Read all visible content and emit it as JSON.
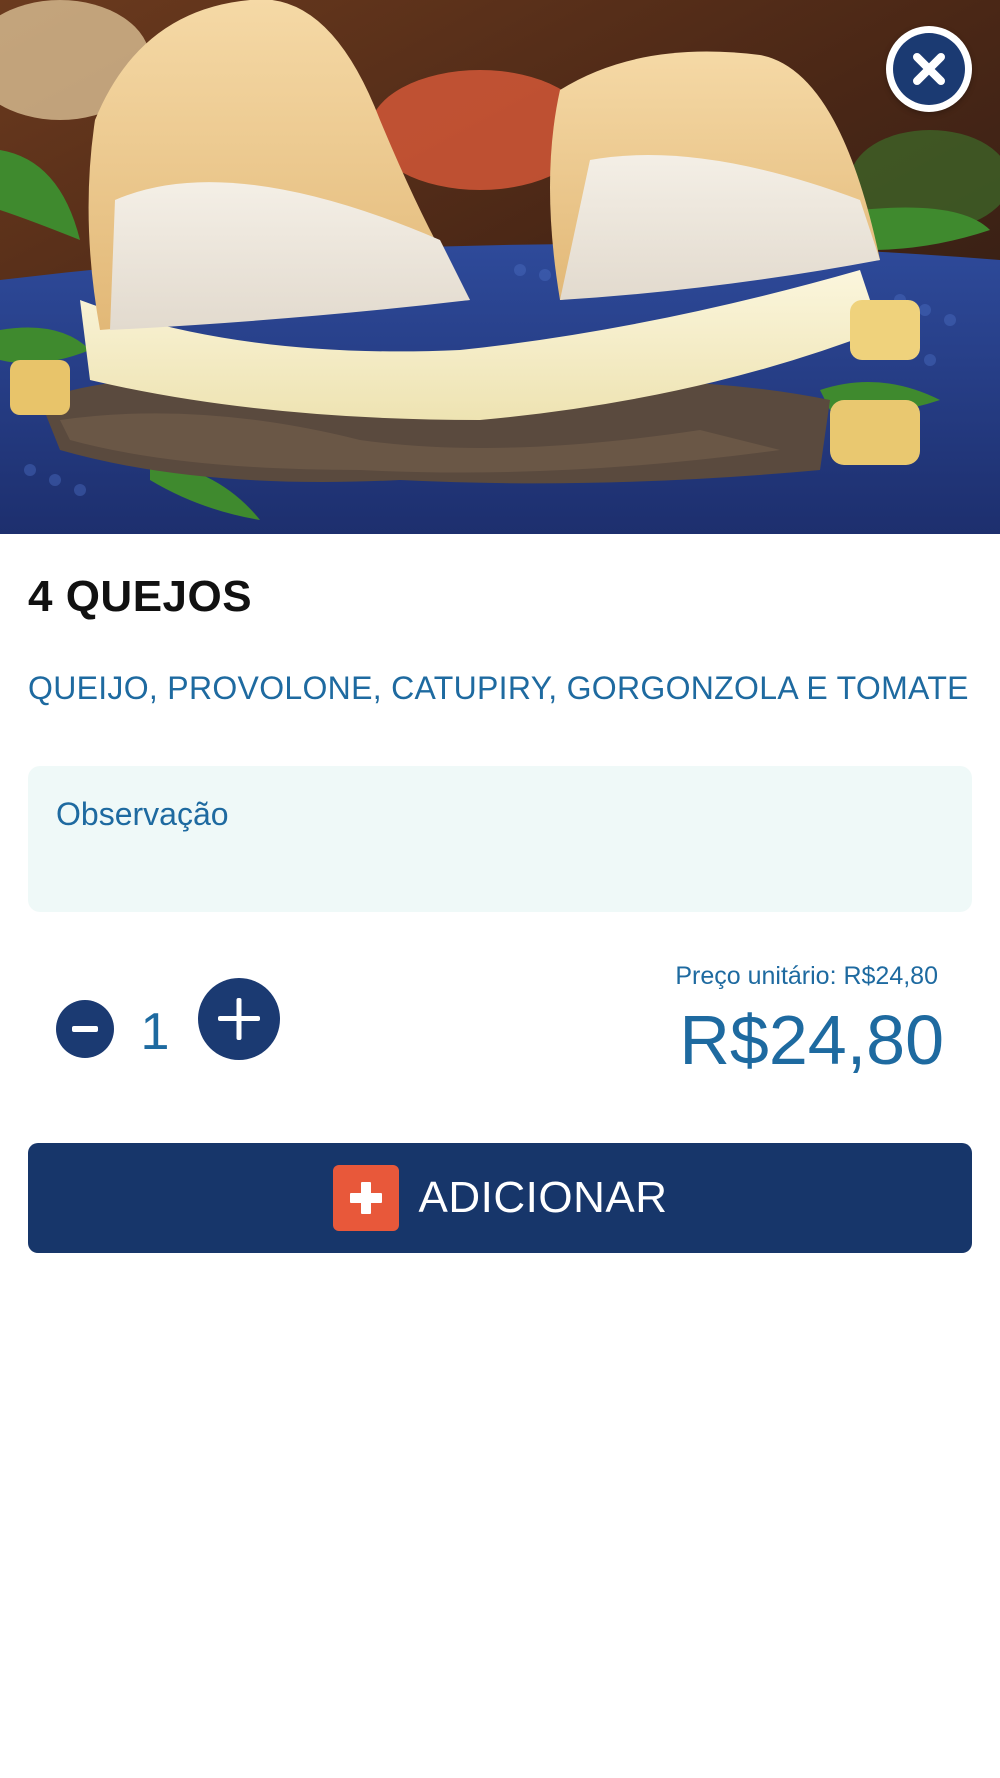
{
  "product": {
    "title": "4 QUEJOS",
    "description": "QUEIJO, PROVOLONE, CATUPIRY, GORGONZOLA E TOMATE"
  },
  "observation": {
    "placeholder": "Observação"
  },
  "quantity": {
    "value": "1"
  },
  "price": {
    "unit_label": "Preço unitário: R$24,80",
    "total": "R$24,80"
  },
  "actions": {
    "add_label": "ADICIONAR"
  },
  "icons": {
    "close": "close-icon",
    "minus": "minus-icon",
    "plus": "plus-icon",
    "add": "plus-icon"
  },
  "colors": {
    "primary": "#17366a",
    "accent_text": "#1e6aa0",
    "add_icon_bg": "#e8583a",
    "observation_bg": "#eff9f8"
  }
}
